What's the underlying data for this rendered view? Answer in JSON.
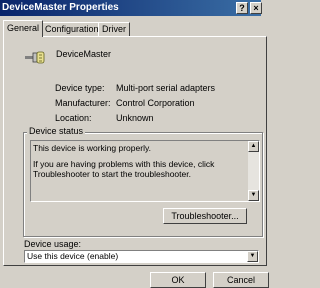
{
  "window": {
    "title": "DeviceMaster Properties",
    "help_btn": "?",
    "close_btn": "×"
  },
  "tabs": [
    {
      "label": "General"
    },
    {
      "label": "Configuration"
    },
    {
      "label": "Driver"
    }
  ],
  "device": {
    "name": "DeviceMaster",
    "icon": "serial-port-icon",
    "type_label": "Device type:",
    "type_value": "Multi-port serial adapters",
    "manufacturer_label": "Manufacturer:",
    "manufacturer_value": "Control Corporation",
    "location_label": "Location:",
    "location_value": "Unknown"
  },
  "status": {
    "legend": "Device status",
    "line1": "This device is working properly.",
    "line2": "If you are having problems with this device, click Troubleshooter to start the troubleshooter.",
    "troubleshooter_btn": "Troubleshooter..."
  },
  "usage": {
    "label": "Device usage:",
    "selected": "Use this device (enable)"
  },
  "footer": {
    "ok": "OK",
    "cancel": "Cancel"
  }
}
